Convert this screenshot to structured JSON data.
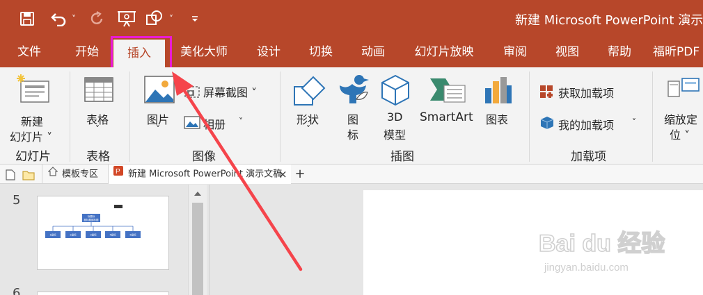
{
  "titlebar": {
    "title": "新建 Microsoft PowerPoint 演示",
    "undo_dropdown": "˅",
    "shape_dropdown": "˅"
  },
  "tabs": [
    "文件",
    "开始",
    "插入",
    "美化大师",
    "设计",
    "切换",
    "动画",
    "幻灯片放映",
    "审阅",
    "视图",
    "帮助",
    "福昕PDF"
  ],
  "active_tab": "插入",
  "highlight_color": "#e91bd5",
  "accent_color": "#b7472a",
  "ribbon": {
    "new_slide": [
      "新建",
      "幻灯片 ˅"
    ],
    "table": [
      "表格",
      "˅"
    ],
    "picture": [
      "图片",
      "˅"
    ],
    "screenshot": "屏幕截图 ˅",
    "album": "相册",
    "album_caret": "˅",
    "shapes": [
      "形状",
      "˅"
    ],
    "icons": [
      "图",
      "标"
    ],
    "model3d": [
      "3D",
      "模型"
    ],
    "smartart": "SmartArt",
    "chart": "图表",
    "get_addins": "获取加载项",
    "my_addins": "我的加载项",
    "my_addins_caret": "˅",
    "zoom": [
      "缩放定",
      "位 ˅"
    ],
    "groups": {
      "slides": "幻灯片",
      "tables": "表格",
      "images": "图像",
      "illustrations": "插图",
      "addins": "加载项"
    }
  },
  "doc_tabs": {
    "templates": "模板专区",
    "document": "新建 Microsoft PowerPoint 演示文稿",
    "close": "×",
    "add": "+"
  },
  "thumbnails": {
    "numbers": [
      "5",
      "6"
    ],
    "orgchart": {
      "top": [
        "标题标",
        "副标题副标题"
      ],
      "children": [
        "1级标",
        "2级标",
        "3级标",
        "4级标",
        "5级标"
      ]
    }
  },
  "watermark": {
    "logo": "Bai du 经验",
    "url": "jingyan.baidu.com"
  }
}
